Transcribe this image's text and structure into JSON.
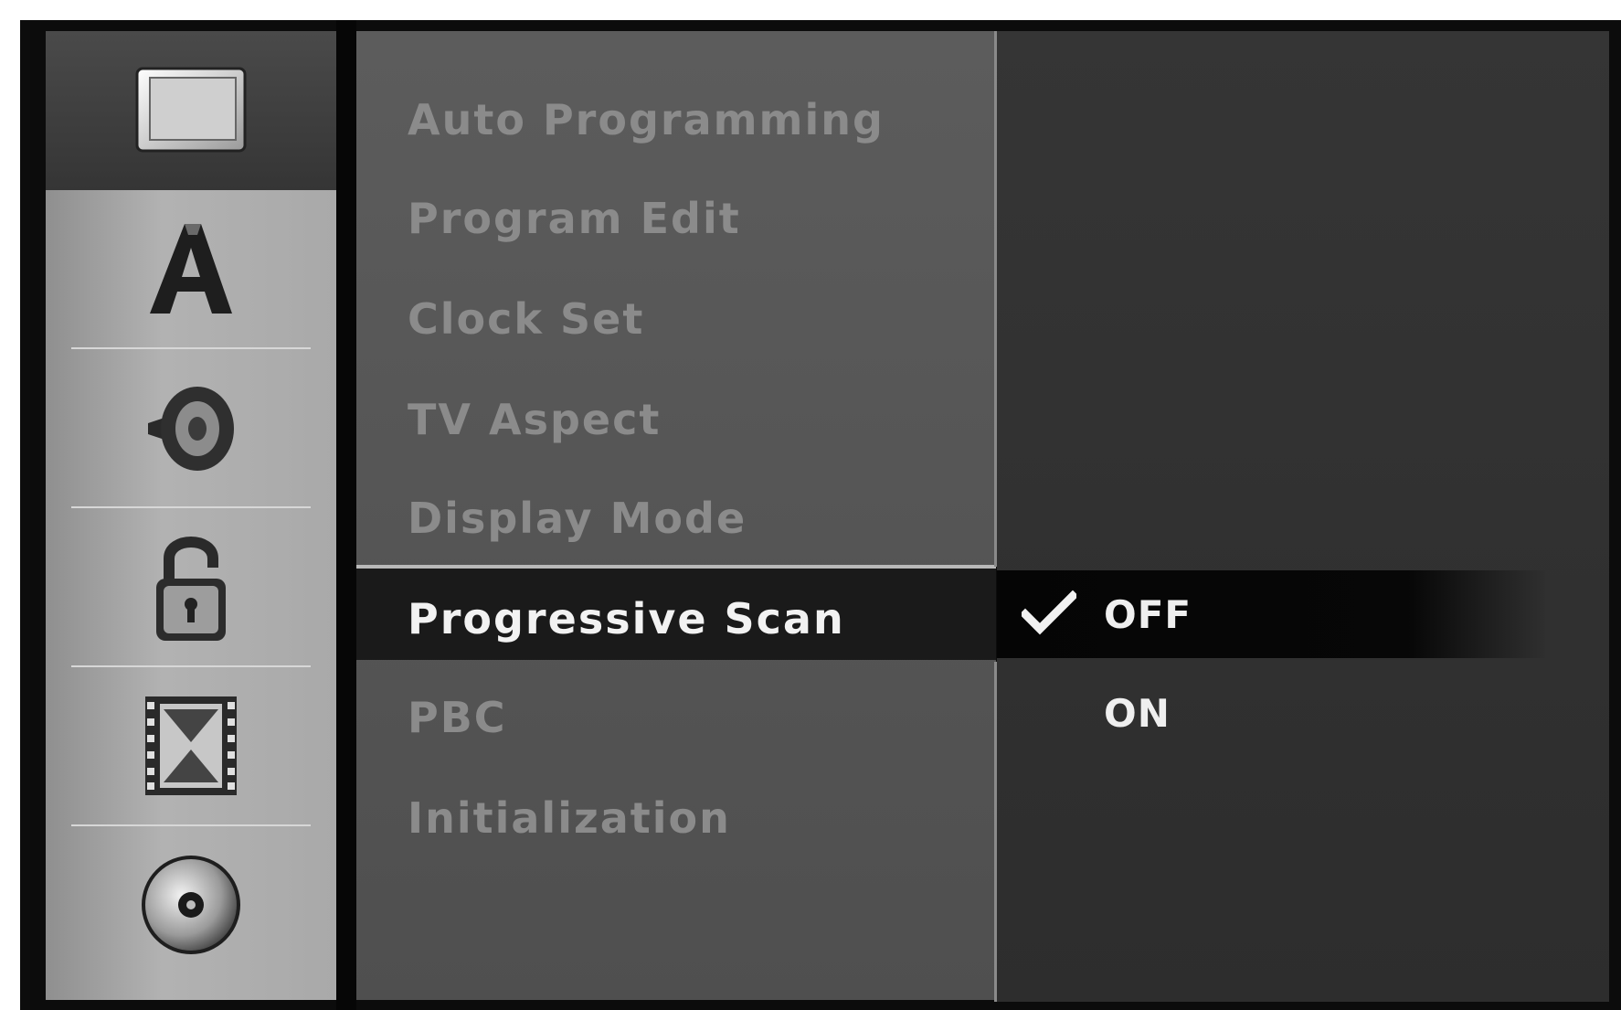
{
  "sidebar": {
    "icons": [
      {
        "name": "picture-icon",
        "active": true
      },
      {
        "name": "language-icon",
        "active": false
      },
      {
        "name": "audio-icon",
        "active": false
      },
      {
        "name": "lock-icon",
        "active": false
      },
      {
        "name": "film-icon",
        "active": false
      },
      {
        "name": "disc-icon",
        "active": false
      }
    ]
  },
  "menu": {
    "items": [
      {
        "label": "Auto Programming"
      },
      {
        "label": "Program Edit"
      },
      {
        "label": "Clock Set"
      },
      {
        "label": "TV Aspect"
      },
      {
        "label": "Display Mode"
      },
      {
        "label": "Progressive Scan"
      },
      {
        "label": "PBC"
      },
      {
        "label": "Initialization"
      }
    ],
    "selected_index": 5
  },
  "options": {
    "items": [
      {
        "label": "OFF",
        "checked": true
      },
      {
        "label": "ON",
        "checked": false
      }
    ]
  },
  "colors": {
    "sidebar_bg": "#a5a5a5",
    "sidebar_active_bg": "#3a3a3a",
    "menu_bg": "#595959",
    "menu_text_inactive": "#8b8b8b",
    "menu_text_selected": "#f2f2f2",
    "options_bg": "#2f2f2f",
    "selected_bar": "#1a1a1a"
  }
}
